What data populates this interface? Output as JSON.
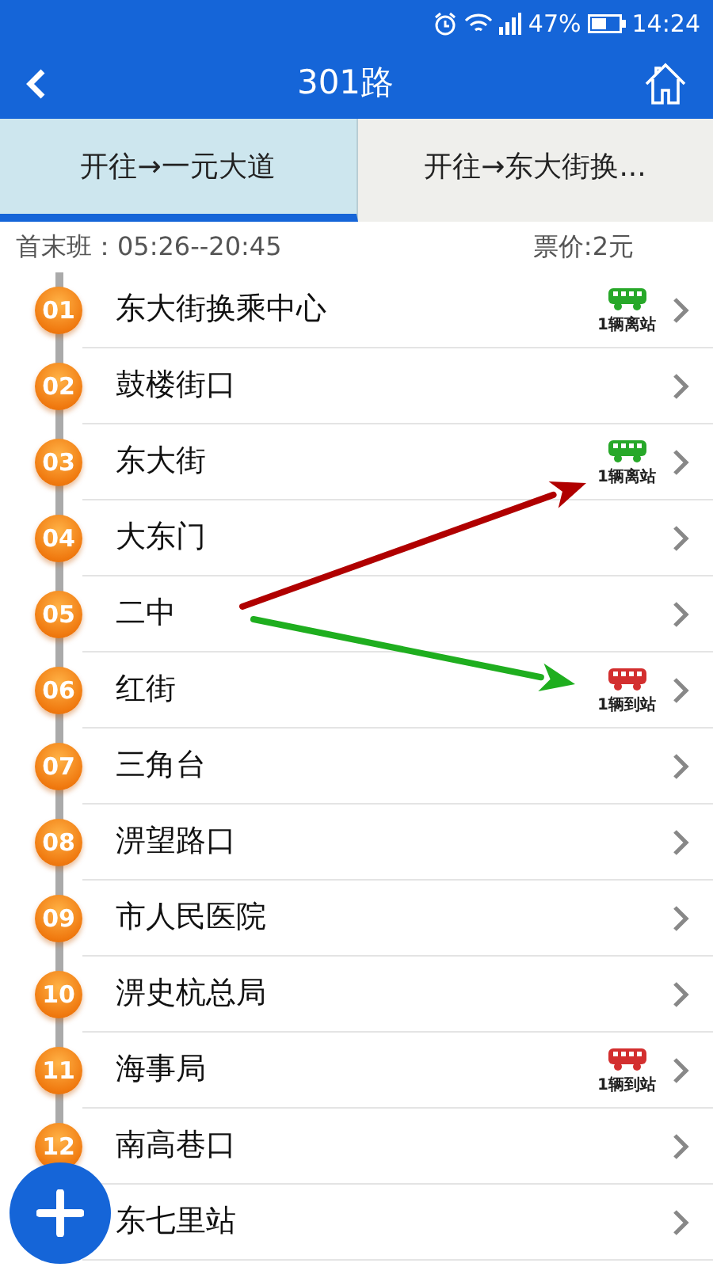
{
  "status_bar": {
    "battery": "47%",
    "time": "14:24"
  },
  "header": {
    "title": "301路"
  },
  "tabs": [
    {
      "label": "开往→一元大道",
      "selected": true
    },
    {
      "label": "开往→东大街换...",
      "selected": false
    }
  ],
  "info": {
    "hours": "首末班：05:26--20:45",
    "fare": "票价:2元"
  },
  "stops": [
    {
      "number": "01",
      "name": "东大街换乘中心",
      "bus": {
        "arrived": false,
        "label": "1辆离站"
      }
    },
    {
      "number": "02",
      "name": "鼓楼街口"
    },
    {
      "number": "03",
      "name": "东大街",
      "bus": {
        "arrived": false,
        "label": "1辆离站"
      }
    },
    {
      "number": "04",
      "name": "大东门"
    },
    {
      "number": "05",
      "name": "二中"
    },
    {
      "number": "06",
      "name": "红街",
      "bus": {
        "arrived": true,
        "label": "1辆到站"
      }
    },
    {
      "number": "07",
      "name": "三角台"
    },
    {
      "number": "08",
      "name": "淠望路口"
    },
    {
      "number": "09",
      "name": "市人民医院"
    },
    {
      "number": "10",
      "name": "淠史杭总局"
    },
    {
      "number": "11",
      "name": "海事局",
      "bus": {
        "arrived": true,
        "label": "1辆到站"
      }
    },
    {
      "number": "12",
      "name": "南高巷口"
    },
    {
      "name": "东七里站"
    }
  ],
  "annotations": [
    {
      "color": "#b00000"
    },
    {
      "color": "#1fae1f"
    }
  ]
}
